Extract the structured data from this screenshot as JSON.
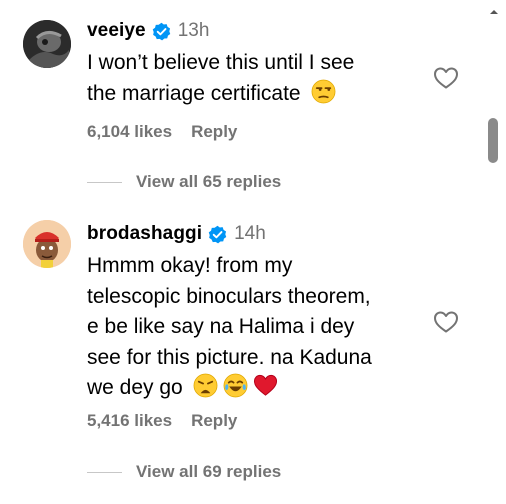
{
  "comments": [
    {
      "username": "veeiye",
      "time": "13h",
      "lines": [
        "I won’t believe this until I see",
        "the marriage certificate"
      ],
      "emojis": [
        "unamused-face-emoji"
      ],
      "likes": "6,104 likes",
      "reply_label": "Reply",
      "view_replies": "View all 65 replies"
    },
    {
      "username": "brodashaggi",
      "time": "14h",
      "lines": [
        "Hmmm okay! from my",
        "telescopic binoculars theorem,",
        "e be like say na Halima i dey",
        "see for this picture. na Kaduna",
        "we dey go"
      ],
      "emojis": [
        "weary-face-emoji",
        "tears-of-joy-emoji",
        "red-heart-emoji"
      ],
      "likes": "5,416 likes",
      "reply_label": "Reply",
      "view_replies": "View all 69 replies"
    }
  ],
  "icons": {
    "verified": "verified-badge-icon",
    "like": "heart-outline-icon",
    "scroll_up": "scroll-up-arrow-icon"
  },
  "colors": {
    "verified_blue": "#0095f6",
    "secondary_text": "#737373",
    "scroll_thumb": "#8a8a8a"
  }
}
